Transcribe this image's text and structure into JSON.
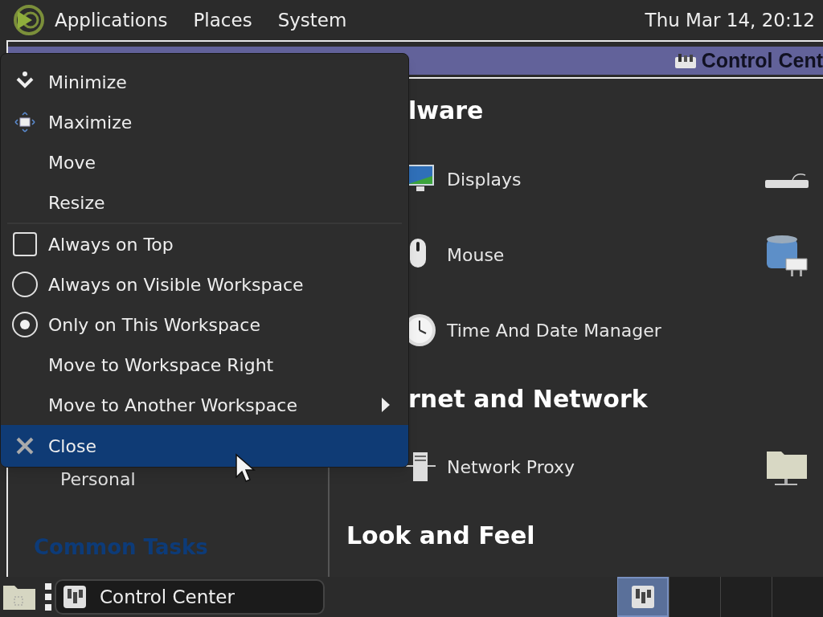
{
  "top_panel": {
    "menus": [
      "Applications",
      "Places",
      "System"
    ],
    "clock": "Thu Mar 14, 20:12"
  },
  "window": {
    "title": "Control Cent",
    "sidebar": {
      "items": [
        "Personal"
      ],
      "section_title": "Common Tasks"
    },
    "sections": [
      {
        "title": "lware",
        "rows": [
          {
            "left": {
              "kind": "display",
              "label": "Displays"
            },
            "right": {
              "kind": "keyboard"
            }
          },
          {
            "left": {
              "kind": "mouse",
              "label": "Mouse"
            },
            "right": {
              "kind": "tank"
            }
          },
          {
            "left": {
              "kind": "clock",
              "label": "Time And Date Manager"
            }
          }
        ]
      },
      {
        "title": "rnet and Network",
        "rows": [
          {
            "left": {
              "kind": "server",
              "label": "Network Proxy"
            },
            "right": {
              "kind": "netfolder"
            }
          }
        ]
      },
      {
        "title": "Look and Feel"
      }
    ]
  },
  "window_menu": {
    "items": [
      {
        "kind": "minimize",
        "label": "Minimize",
        "selected": false
      },
      {
        "kind": "maximize",
        "label": "Maximize",
        "selected": false
      },
      {
        "kind": "action",
        "label": "Move",
        "selected": false
      },
      {
        "kind": "action",
        "label": "Resize",
        "selected": false
      },
      {
        "kind": "separator"
      },
      {
        "kind": "check",
        "label": "Always on Top",
        "checked": false,
        "selected": false
      },
      {
        "kind": "radio",
        "label": "Always on Visible Workspace",
        "checked": false,
        "selected": false
      },
      {
        "kind": "radio",
        "label": "Only on This Workspace",
        "checked": true,
        "selected": false
      },
      {
        "kind": "action",
        "label": "Move to Workspace Right",
        "selected": false
      },
      {
        "kind": "submenu",
        "label": "Move to Another Workspace",
        "selected": false
      },
      {
        "kind": "close",
        "label": "Close",
        "selected": true
      }
    ]
  },
  "taskbar": {
    "tasks": [
      {
        "label": "Control Center"
      }
    ],
    "workspaces": [
      {
        "selected": true
      },
      {
        "selected": false
      },
      {
        "selected": false
      },
      {
        "selected": false
      }
    ]
  }
}
